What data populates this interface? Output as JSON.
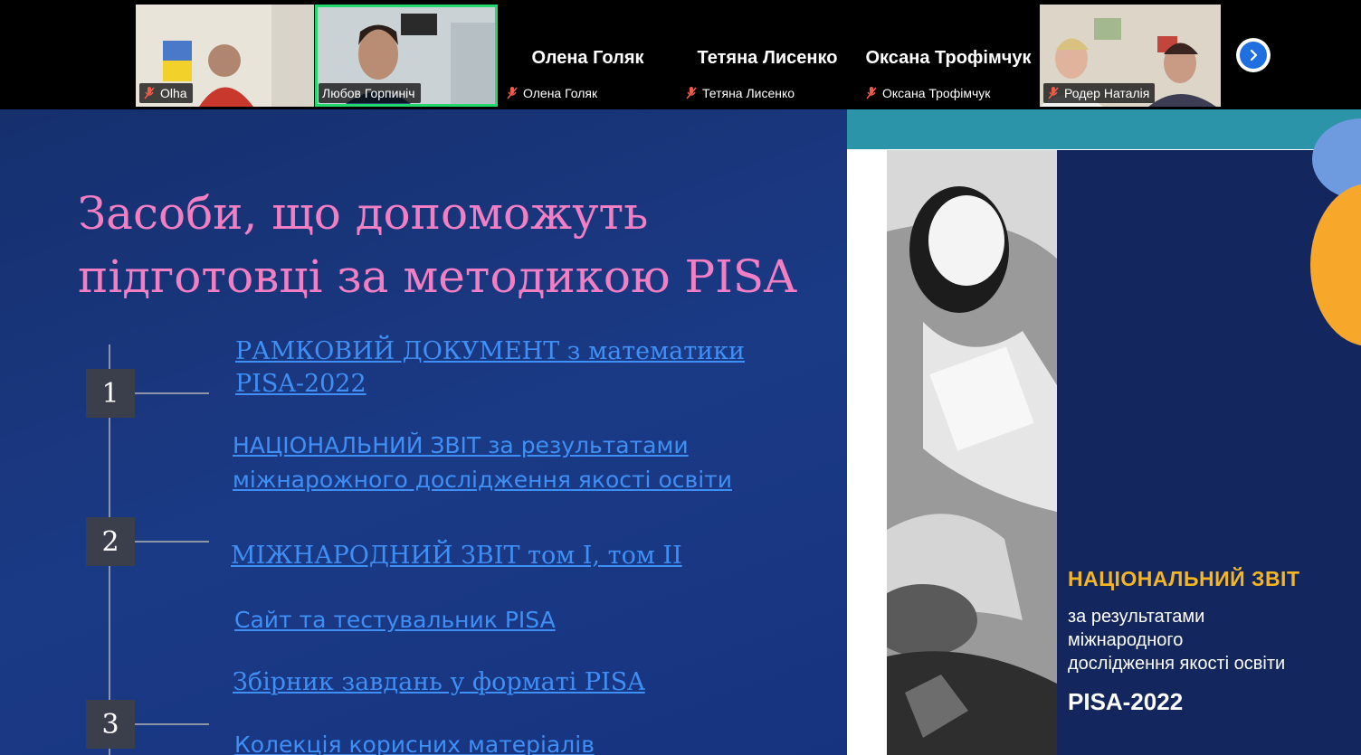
{
  "participants": [
    {
      "display": "",
      "tag": "Olha",
      "muted": true
    },
    {
      "display": "",
      "tag": "Любов Горпиніч",
      "muted": true,
      "active": true
    },
    {
      "display": "Олена Голяк",
      "tag": "Олена Голяк",
      "muted": true
    },
    {
      "display": "Тетяна Лисенко",
      "tag": "Тетяна Лисенко",
      "muted": true
    },
    {
      "display": "Оксана  Трофімчук",
      "tag": "Оксана Трофімчук",
      "muted": true
    },
    {
      "display": "",
      "tag": "Родер Наталія",
      "muted": true
    }
  ],
  "next_button_icon": "chevron-right-icon",
  "slide": {
    "title": "Засоби, що допоможуть\nпідготовці  за методикою PISA",
    "numbers": [
      "1",
      "2",
      "3"
    ],
    "links": [
      "РАМКОВИЙ ДОКУМЕНТ з математики \nPISA-2022",
      "НАЦІОНАЛЬНИЙ ЗВІТ за результатами \nміжнарожного  дослідження якості освіти",
      "МІЖНАРОДНИЙ ЗВІТ том І, том ІІ",
      "Сайт та тестувальник PISA",
      "Збірник завдань у форматі PISA",
      "Колекція корисних матеріалів"
    ],
    "cover": {
      "title": "НАЦІОНАЛЬНИЙ ЗВІТ",
      "subtitle": "за результатами\nміжнародного\nдослідження якості освіти",
      "pisa": "PISA-2022"
    }
  },
  "colors": {
    "slide_title": "#f27fc4",
    "link": "#3f8ff5",
    "active_speaker_border": "#23d96b",
    "cover_title": "#f4b623",
    "cover_panel": "#13275e"
  }
}
